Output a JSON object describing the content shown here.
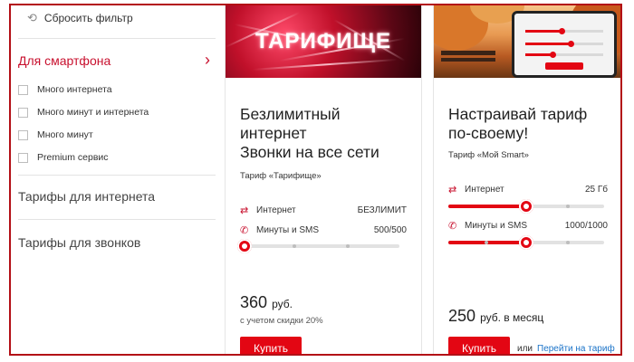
{
  "sidebar": {
    "reset_label": "Сбросить фильтр",
    "active_category": "Для смартфона",
    "options": [
      {
        "label": "Много интернета"
      },
      {
        "label": "Много минут и интернета"
      },
      {
        "label": "Много минут"
      },
      {
        "label": "Premium сервис"
      }
    ],
    "categories": [
      "Тарифы для интернета",
      "Тарифы для звонков"
    ]
  },
  "cards": [
    {
      "banner_title": "ТАРИФИЩЕ",
      "title_lines": [
        "Безлимитный",
        "интернет",
        "Звонки на все сети"
      ],
      "subtitle": "Тариф «Тарифище»",
      "rows": [
        {
          "label": "Интернет",
          "value": "БЕЗЛИМИТ",
          "level": 0
        },
        {
          "label": "Минуты и SMS",
          "value": "500/500",
          "level": 0
        }
      ],
      "price": "360",
      "price_unit": "руб.",
      "discount": "с учетом скидки 20%",
      "buy_label": "Купить"
    },
    {
      "title_lines": [
        "Настраивай тариф",
        "по-своему!"
      ],
      "subtitle": "Тариф «Мой Smart»",
      "rows": [
        {
          "label": "Интернет",
          "value": "25 Гб",
          "level": 0.5
        },
        {
          "label": "Минуты и SMS",
          "value": "1000/1000",
          "level": 0.5
        }
      ],
      "price": "250",
      "price_unit": "руб. в месяц",
      "buy_label": "Купить",
      "or_label": "или",
      "link_label": "Перейти на тариф"
    }
  ],
  "colors": {
    "accent": "#e30613",
    "frame": "#b30f16",
    "link": "#1a73c8"
  },
  "icons": {
    "reset": "undo-icon",
    "chevron": "chevron-right-icon",
    "internet": "arrows-swap-icon",
    "calls": "phone-icon"
  }
}
